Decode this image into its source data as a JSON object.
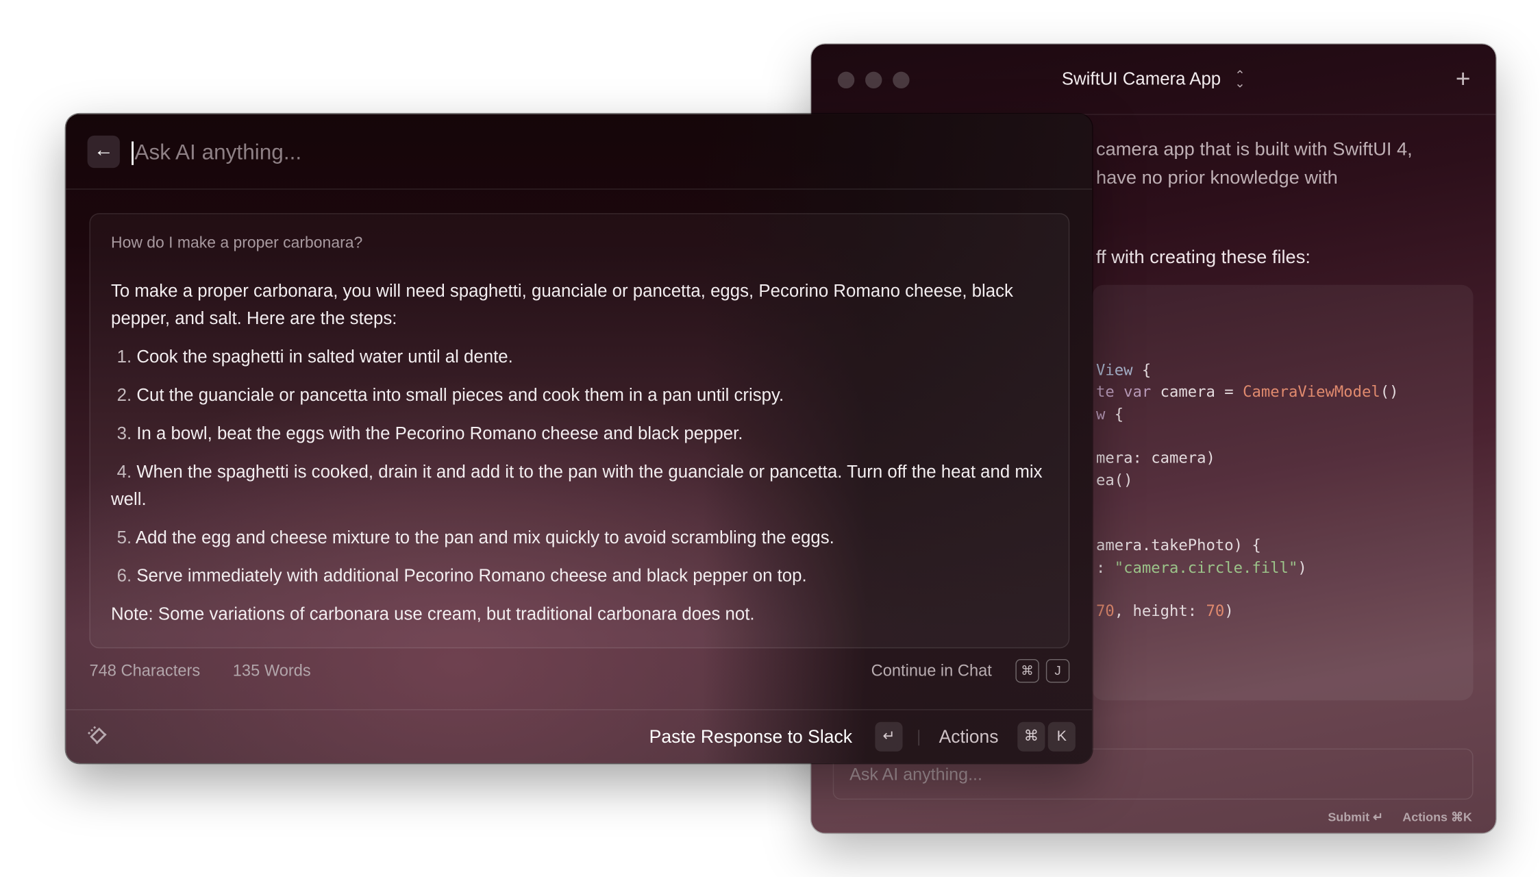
{
  "back_window": {
    "title": "SwiftUI Camera App",
    "message_lines": [
      "camera app that is built with SwiftUI 4,",
      "have no prior knowledge with"
    ],
    "intro_line": "ff with creating these files:",
    "code_lines": [
      [
        {
          "t": "View",
          "k": "type"
        },
        {
          "t": " {",
          "k": ""
        }
      ],
      [
        {
          "t": "te ",
          "k": "kw"
        },
        {
          "t": "var",
          "k": "kw"
        },
        {
          "t": " camera = ",
          "k": ""
        },
        {
          "t": "CameraViewModel",
          "k": "fn"
        },
        {
          "t": "()",
          "k": ""
        }
      ],
      [
        {
          "t": "w",
          "k": "kw"
        },
        {
          "t": " {",
          "k": ""
        }
      ],
      [],
      [
        {
          "t": "mera: camera)",
          "k": ""
        }
      ],
      [
        {
          "t": "ea()",
          "k": ""
        }
      ],
      [],
      [],
      [
        {
          "t": "amera.takePhoto) {",
          "k": ""
        }
      ],
      [
        {
          "t": ": ",
          "k": ""
        },
        {
          "t": "\"camera.circle.fill\"",
          "k": "str"
        },
        {
          "t": ")",
          "k": ""
        }
      ],
      [],
      [
        {
          "t": "70",
          "k": "num"
        },
        {
          "t": ", height: ",
          "k": ""
        },
        {
          "t": "70",
          "k": "num"
        },
        {
          "t": ")",
          "k": ""
        }
      ]
    ],
    "input_placeholder": "Ask AI anything...",
    "submit_label": "Submit ↵",
    "actions_label": "Actions ⌘K",
    "add_icon": "plus-icon",
    "switcher_icon": "chevron-up-down-icon"
  },
  "front_window": {
    "back_icon": "arrow-left-icon",
    "input_placeholder": "Ask AI anything...",
    "question": "How do I make a proper carbonara?",
    "answer_intro": "To make a proper carbonara, you will need spaghetti, guanciale or pancetta, eggs, Pecorino Romano cheese, black pepper, and salt. Here are the steps:",
    "steps": [
      {
        "n": "1.",
        "text": "Cook the spaghetti in salted water until al dente."
      },
      {
        "n": "2.",
        "text": "Cut the guanciale or pancetta into small pieces and cook them in a pan until crispy."
      },
      {
        "n": "3.",
        "text": "In a bowl, beat the eggs with the Pecorino Romano cheese and black pepper."
      },
      {
        "n": "4.",
        "text": "When the spaghetti is cooked, drain it and add it to the pan with the guanciale or pancetta. Turn off the heat and mix well."
      },
      {
        "n": "5.",
        "text": "Add the egg and cheese mixture to the pan and mix quickly to avoid scrambling the eggs."
      },
      {
        "n": "6.",
        "text": "Serve immediately with additional Pecorino Romano cheese and black pepper on top."
      }
    ],
    "note": "Note: Some variations of carbonara use cream, but traditional carbonara does not.",
    "characters": "748 Characters",
    "words": "135 Words",
    "continue_label": "Continue in Chat",
    "continue_keys": [
      "⌘",
      "J"
    ],
    "primary_action": "Paste Response to Slack",
    "primary_key": "↵",
    "actions_label": "Actions",
    "actions_keys": [
      "⌘",
      "K"
    ]
  },
  "colors": {
    "string": "#9cc48a",
    "function": "#e08a6e",
    "type": "#a8b4cc",
    "keyword": "#b89ab8"
  }
}
